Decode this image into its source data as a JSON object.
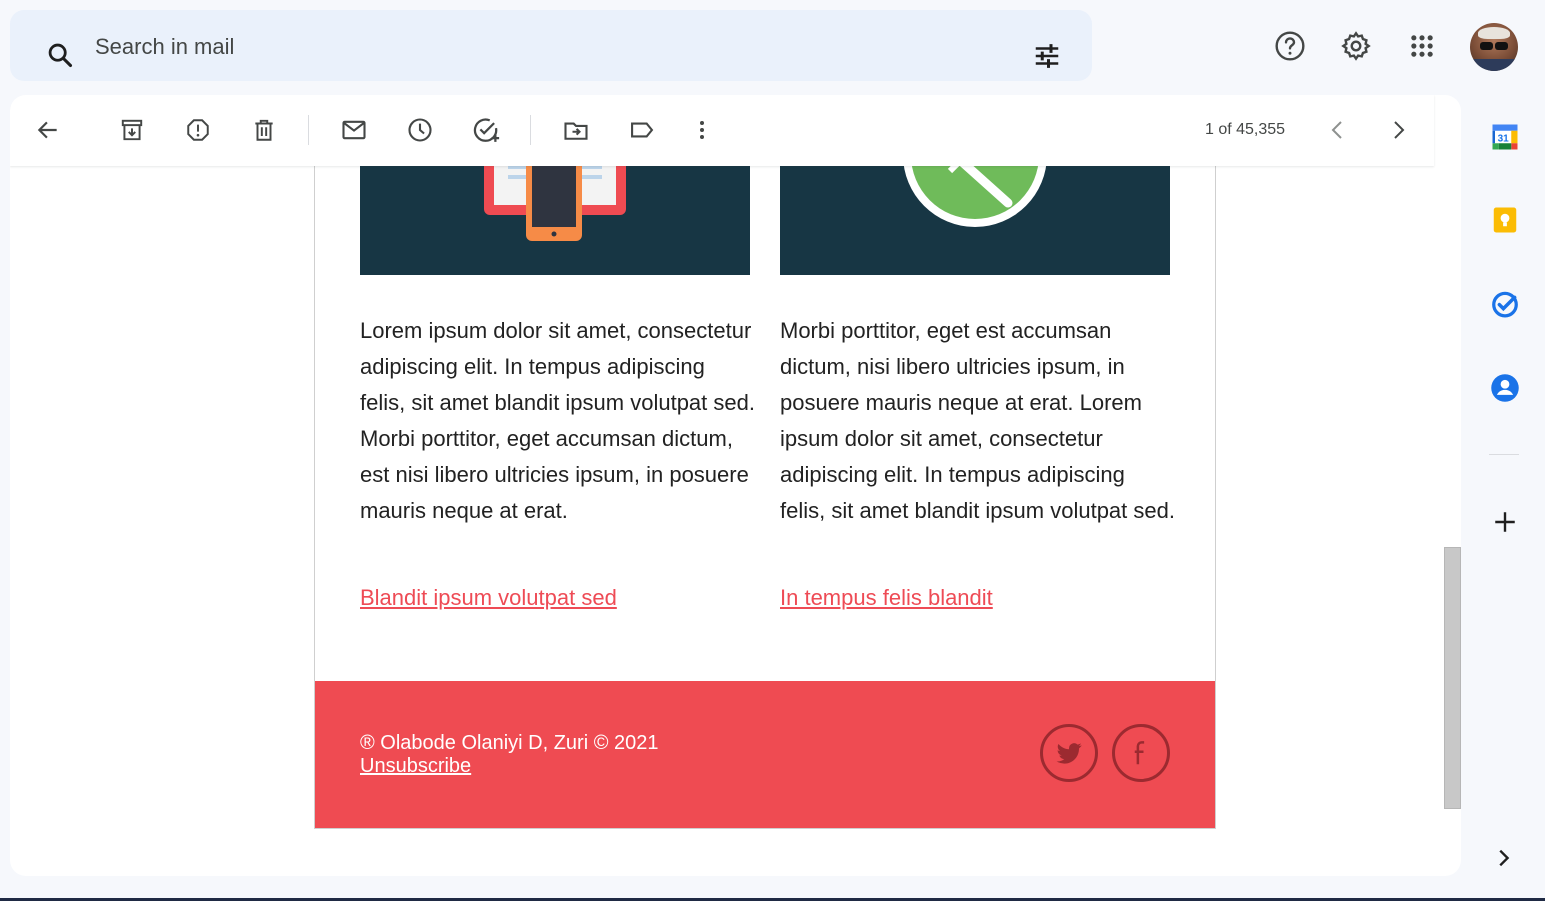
{
  "search": {
    "placeholder": "Search in mail"
  },
  "header_icons": [
    "help-icon",
    "settings-icon",
    "apps-grid-icon",
    "account-avatar"
  ],
  "toolbar": {
    "pager_text": "1 of 45,355",
    "icons": [
      "back-arrow-icon",
      "archive-icon",
      "report-spam-icon",
      "delete-icon",
      "mark-unread-icon",
      "snooze-icon",
      "add-to-tasks-icon",
      "move-to-icon",
      "label-icon",
      "more-vert-icon",
      "older-icon",
      "newer-icon"
    ]
  },
  "email": {
    "left_column": {
      "text": "Lorem ipsum dolor sit amet, consectetur adipiscing elit. In tempus adipiscing felis, sit amet blandit ipsum volutpat sed. Morbi porttitor, eget accumsan dictum, est nisi libero ultricies ipsum, in posuere mauris neque at erat.",
      "link": "Blandit ipsum volutpat sed"
    },
    "right_column": {
      "text": "Morbi porttitor, eget est accumsan dictum, nisi libero ultricies ipsum, in posuere mauris neque at erat. Lorem ipsum dolor sit amet, consectetur adipiscing elit. In tempus adipiscing felis, sit amet blandit ipsum volutpat sed.",
      "link": "In tempus felis blandit"
    },
    "footer": {
      "copyright": "® Olabode Olaniyi D, Zuri © 2021",
      "unsubscribe": "Unsubscribe",
      "social_icons": [
        "twitter-icon",
        "facebook-icon"
      ]
    }
  },
  "side_panel": {
    "calendar_day": "31",
    "icons": [
      "calendar-icon",
      "keep-icon",
      "tasks-icon",
      "contacts-icon",
      "add-addon-icon",
      "expand-panel-icon"
    ]
  },
  "colors": {
    "accent_red": "#ef4b52",
    "link_red": "#ee4b55",
    "hero_dark": "#173644",
    "search_bg": "#eaf1fb",
    "page_bg": "#f6f8fc"
  }
}
